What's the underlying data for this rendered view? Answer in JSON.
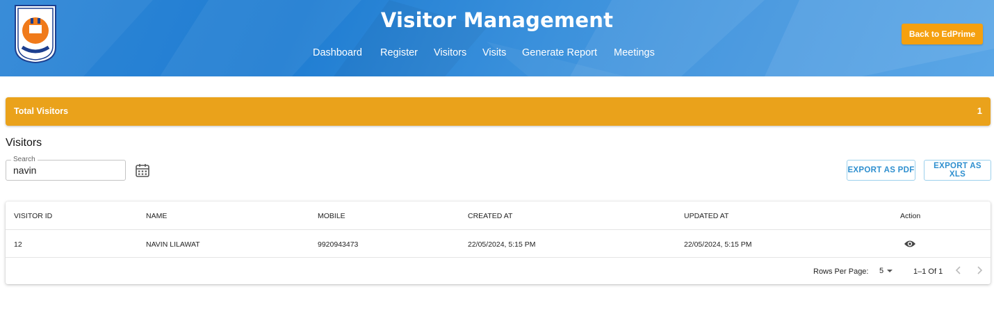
{
  "header": {
    "title": "Visitor Management",
    "nav": [
      {
        "label": "Dashboard"
      },
      {
        "label": "Register"
      },
      {
        "label": "Visitors"
      },
      {
        "label": "Visits"
      },
      {
        "label": "Generate Report"
      },
      {
        "label": "Meetings"
      }
    ],
    "back_button": "Back to EdPrime"
  },
  "summary": {
    "label": "Total Visitors",
    "count": "1"
  },
  "section_title": "Visitors",
  "search": {
    "label": "Search",
    "value": "navin"
  },
  "toolbar": {
    "export_pdf": "EXPORT AS PDF",
    "export_xls": "EXPORT AS XLS"
  },
  "table": {
    "columns": [
      "VISITOR ID",
      "NAME",
      "MOBILE",
      "CREATED AT",
      "UPDATED AT",
      "Action"
    ],
    "rows": [
      {
        "visitor_id": "12",
        "name": "NAVIN LILAWAT",
        "mobile": "9920943473",
        "created_at": "22/05/2024, 5:15 PM",
        "updated_at": "22/05/2024, 5:15 PM",
        "action_icon": "eye-icon"
      }
    ]
  },
  "pagination": {
    "rows_per_page_label": "Rows Per Page:",
    "rows_per_page": "5",
    "range": "1–1 Of 1"
  },
  "colors": {
    "header_blue": "#1f7dd2",
    "accent_orange": "#f5a00f",
    "summary_bar": "#eaa21b",
    "export_text": "#2e8fcf"
  }
}
